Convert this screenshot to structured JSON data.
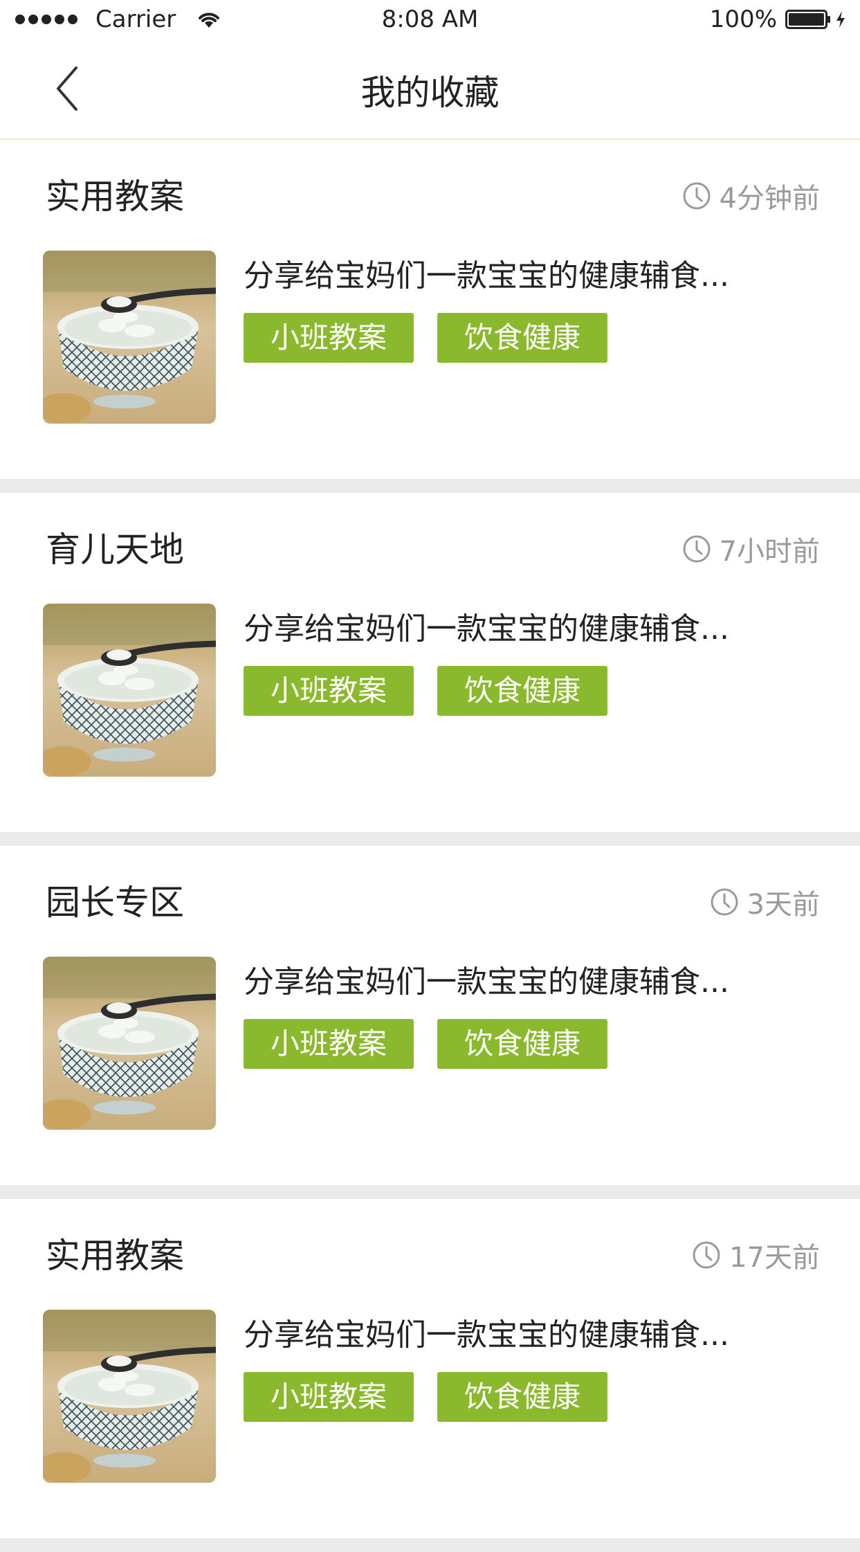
{
  "status_bar": {
    "carrier": "Carrier",
    "time": "8:08 AM",
    "battery": "100%"
  },
  "nav": {
    "title": "我的收藏"
  },
  "cards": [
    {
      "category": "实用教案",
      "time": "4分钟前",
      "text": "分享给宝妈们一款宝宝的健康辅食...",
      "tags": [
        "小班教案",
        "饮食健康"
      ]
    },
    {
      "category": "育儿天地",
      "time": "7小时前",
      "text": "分享给宝妈们一款宝宝的健康辅食...",
      "tags": [
        "小班教案",
        "饮食健康"
      ]
    },
    {
      "category": "园长专区",
      "time": "3天前",
      "text": "分享给宝妈们一款宝宝的健康辅食...",
      "tags": [
        "小班教案",
        "饮食健康"
      ]
    },
    {
      "category": "实用教案",
      "time": "17天前",
      "text": "分享给宝妈们一款宝宝的健康辅食...",
      "tags": [
        "小班教案",
        "饮食健康"
      ]
    }
  ],
  "colors": {
    "tag_green": "#8ab92d",
    "time_gray": "#9a9a9a",
    "separator": "#ebebeb"
  }
}
